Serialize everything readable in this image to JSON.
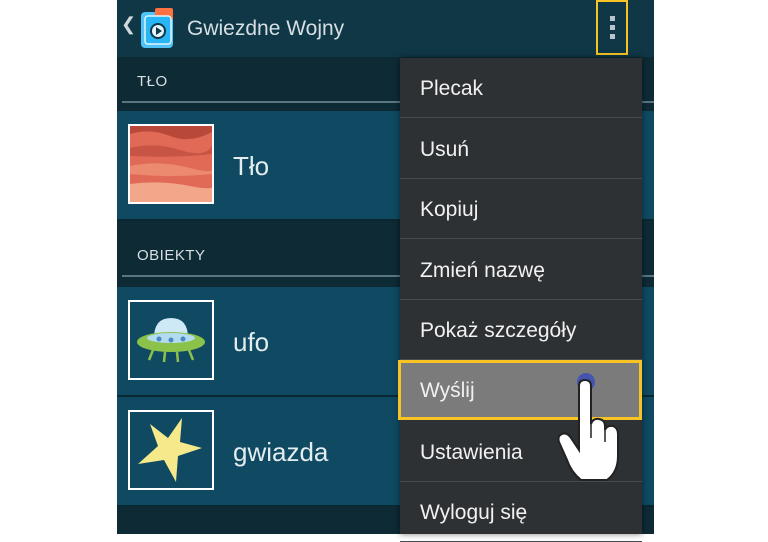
{
  "app": {
    "title": "Gwiezdne Wojny"
  },
  "sections": {
    "background": {
      "label": "TŁO",
      "item": {
        "label": "Tło"
      }
    },
    "objects": {
      "label": "OBIEKTY",
      "items": [
        {
          "label": "ufo"
        },
        {
          "label": "gwiazda"
        }
      ]
    }
  },
  "menu": {
    "items": [
      {
        "label": "Plecak"
      },
      {
        "label": "Usuń"
      },
      {
        "label": "Kopiuj"
      },
      {
        "label": "Zmień nazwę"
      },
      {
        "label": "Pokaż szczegóły"
      },
      {
        "label": "Wyślij",
        "highlighted": true
      },
      {
        "label": "Ustawienia"
      },
      {
        "label": "Wyloguj się"
      }
    ]
  },
  "colors": {
    "highlight": "#f7c325",
    "action_bar": "#0f3746",
    "row": "#0f4a62",
    "menu": "#2d3133"
  },
  "icons": [
    "back-icon",
    "app-logo-icon",
    "overflow-menu-icon",
    "tap-hand-icon"
  ]
}
